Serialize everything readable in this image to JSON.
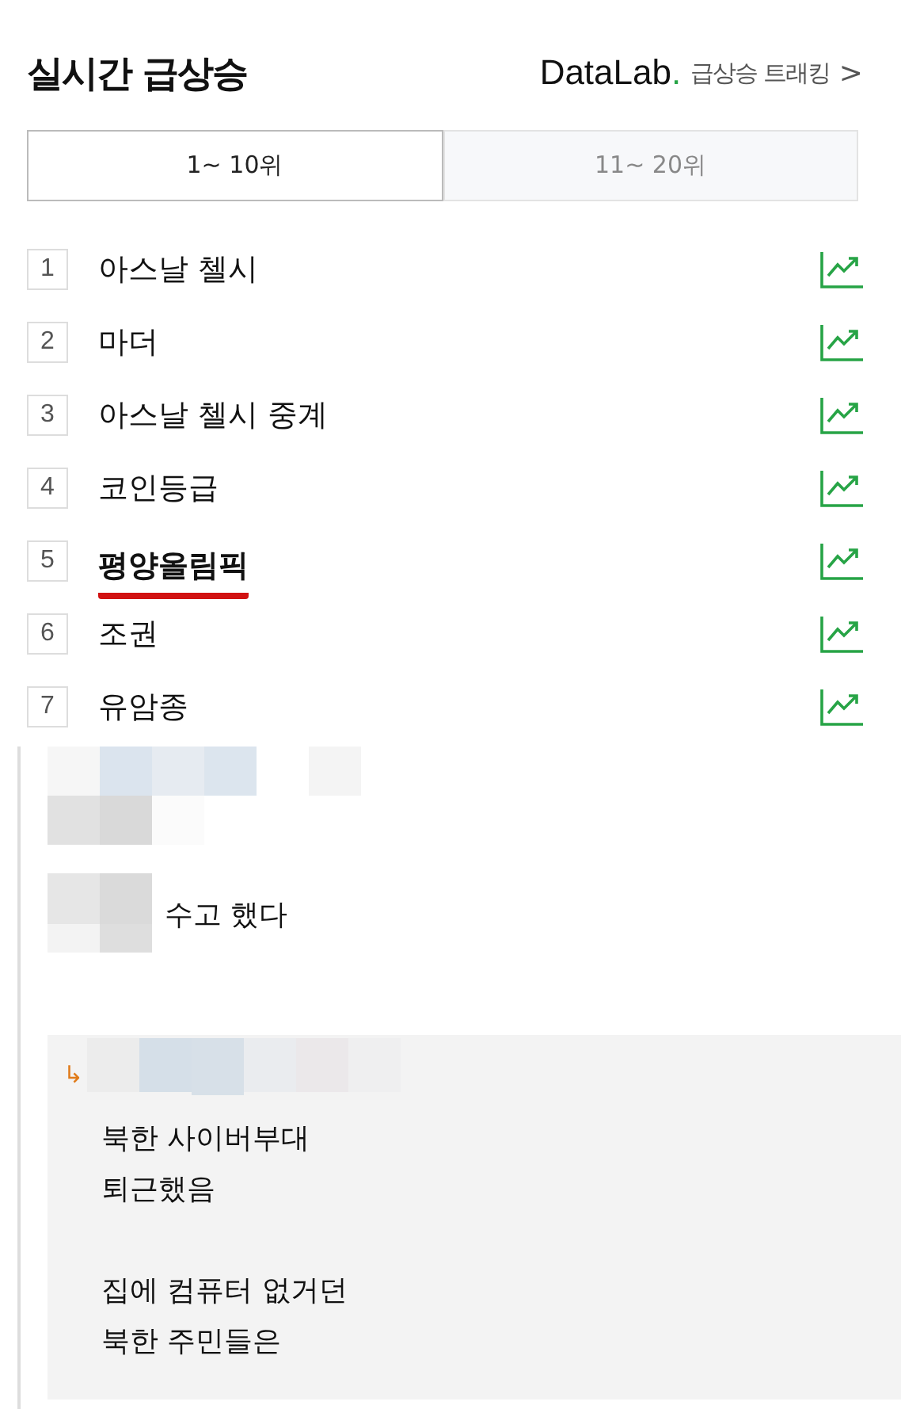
{
  "header": {
    "title": "실시간 급상승",
    "brand": "DataLab",
    "brand_dot": ".",
    "link": "급상승 트래킹",
    "link_arrow": ">"
  },
  "tabs": [
    {
      "label": "1~ 10위",
      "selected": true
    },
    {
      "label": "11~ 20위",
      "selected": false
    }
  ],
  "ranking": [
    {
      "rank": "1",
      "keyword": "아스날 첼시",
      "emphasized": false
    },
    {
      "rank": "2",
      "keyword": "마더",
      "emphasized": false
    },
    {
      "rank": "3",
      "keyword": "아스날 첼시 중계",
      "emphasized": false
    },
    {
      "rank": "4",
      "keyword": "코인등급",
      "emphasized": false
    },
    {
      "rank": "5",
      "keyword": "평양올림픽",
      "emphasized": true
    },
    {
      "rank": "6",
      "keyword": "조권",
      "emphasized": false
    },
    {
      "rank": "7",
      "keyword": "유암종",
      "emphasized": false
    }
  ],
  "comments": [
    {
      "text": "수고 했다"
    }
  ],
  "reply": {
    "arrow": "↳",
    "text": "북한 사이버부대\n퇴근했음\n\n집에 컴퓨터 없거던\n북한 주민들은"
  }
}
